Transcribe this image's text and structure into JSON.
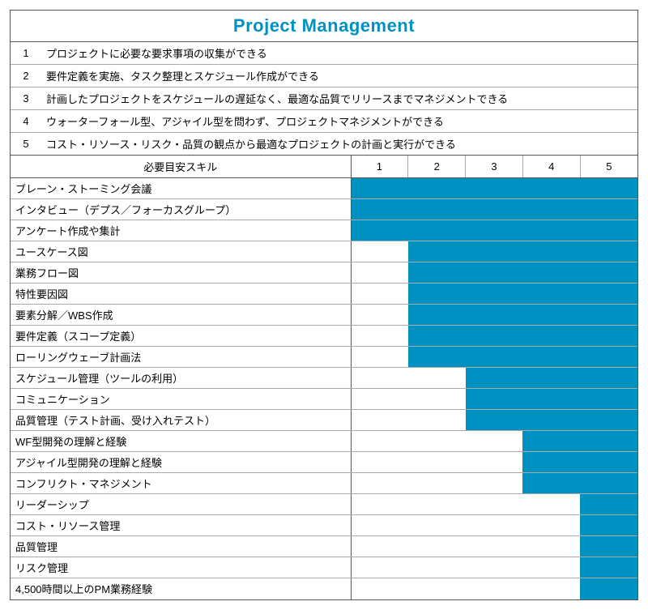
{
  "title": "Project Management",
  "levels": [
    {
      "n": "1",
      "text": "プロジェクトに必要な要求事項の収集ができる"
    },
    {
      "n": "2",
      "text": "要件定義を実施、タスク整理とスケジュール作成ができる"
    },
    {
      "n": "3",
      "text": "計画したプロジェクトをスケジュールの遅延なく、最適な品質でリリースまでマネジメントできる"
    },
    {
      "n": "4",
      "text": "ウォーターフォール型、アジャイル型を問わず、プロジェクトマネジメントができる"
    },
    {
      "n": "5",
      "text": "コスト・リソース・リスク・品質の観点から最適なプロジェクトの計画と実行ができる"
    }
  ],
  "skill_header": "必要目安スキル",
  "level_headers": [
    "1",
    "2",
    "3",
    "4",
    "5"
  ],
  "skills": [
    {
      "name": "ブレーン・ストーミング会議",
      "from": 1
    },
    {
      "name": "インタビュー（デプス／フォーカスグループ）",
      "from": 1
    },
    {
      "name": "アンケート作成や集計",
      "from": 1
    },
    {
      "name": "ユースケース図",
      "from": 2
    },
    {
      "name": "業務フロー図",
      "from": 2
    },
    {
      "name": "特性要因図",
      "from": 2
    },
    {
      "name": "要素分解／WBS作成",
      "from": 2
    },
    {
      "name": "要件定義（スコープ定義）",
      "from": 2
    },
    {
      "name": "ローリングウェーブ計画法",
      "from": 2
    },
    {
      "name": "スケジュール管理（ツールの利用）",
      "from": 3
    },
    {
      "name": "コミュニケーション",
      "from": 3
    },
    {
      "name": "品質管理（テスト計画、受け入れテスト）",
      "from": 3
    },
    {
      "name": "WF型開発の理解と経験",
      "from": 4
    },
    {
      "name": "アジャイル型開発の理解と経験",
      "from": 4
    },
    {
      "name": "コンフリクト・マネジメント",
      "from": 4
    },
    {
      "name": "リーダーシップ",
      "from": 5
    },
    {
      "name": "コスト・リソース管理",
      "from": 5
    },
    {
      "name": "品質管理",
      "from": 5
    },
    {
      "name": "リスク管理",
      "from": 5
    },
    {
      "name": "4,500時間以上のPM業務経験",
      "from": 5
    }
  ]
}
